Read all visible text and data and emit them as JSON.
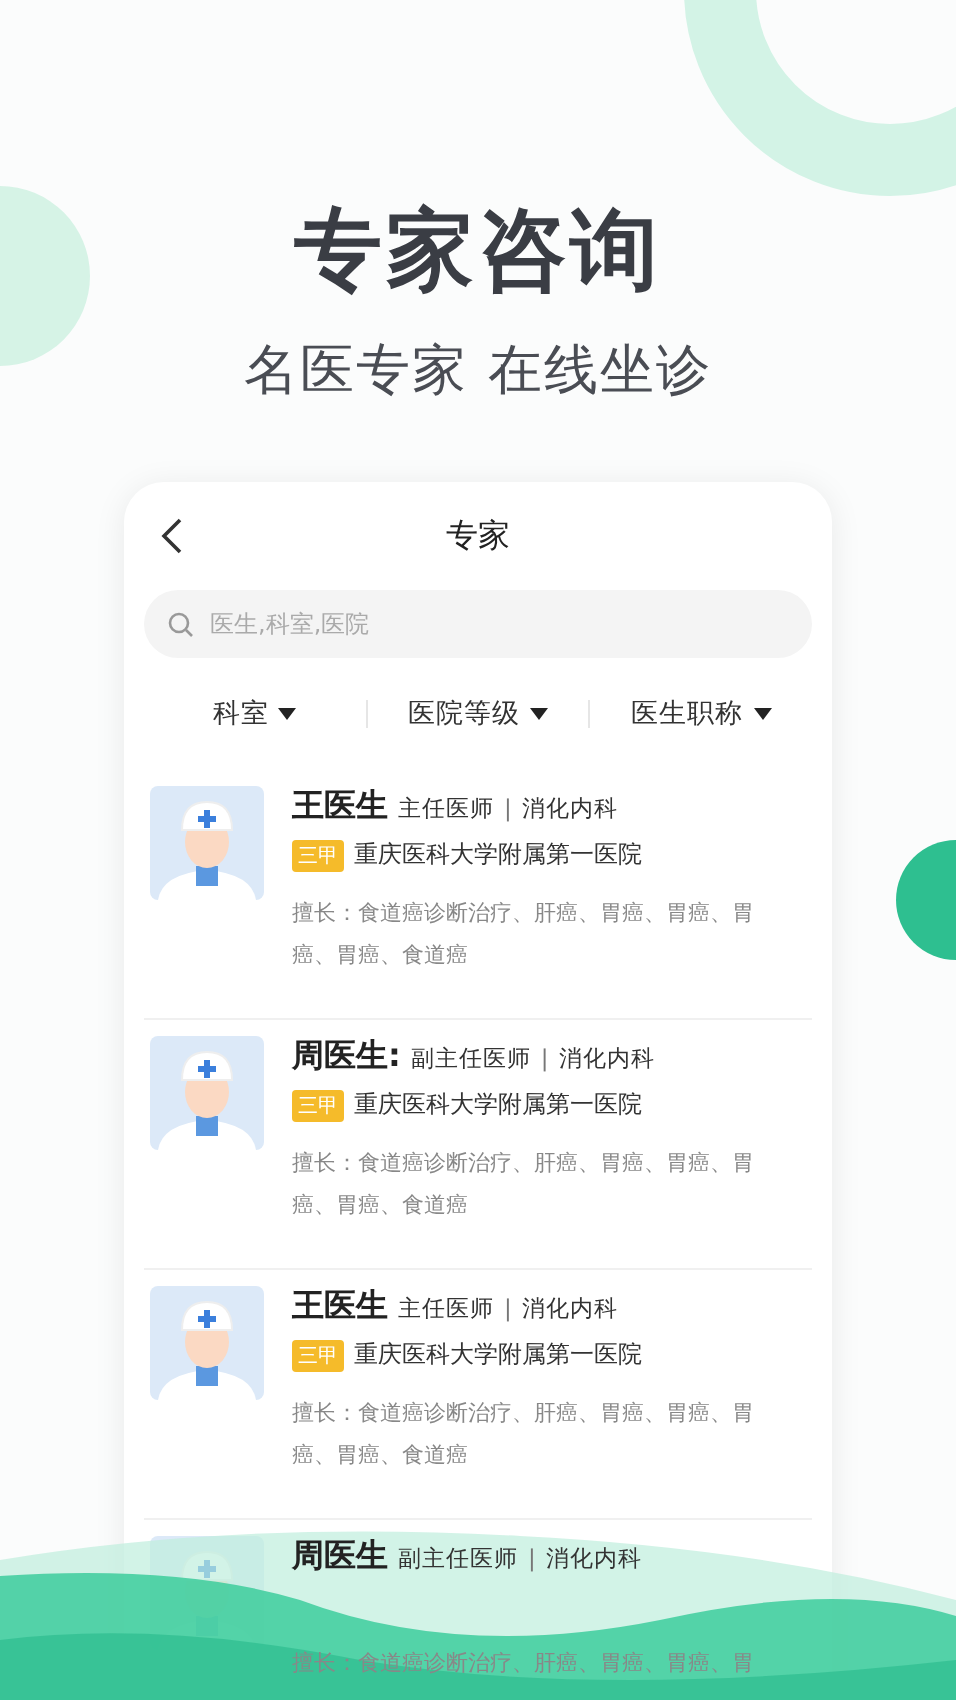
{
  "hero": {
    "title": "专家咨询",
    "subtitle": "名医专家 在线坐诊"
  },
  "screen": {
    "title": "专家",
    "search": {
      "placeholder": "医生,科室,医院"
    },
    "filters": [
      "科室",
      "医院等级",
      "医生职称"
    ],
    "doctors": [
      {
        "name": "王医生",
        "title": "主任医师",
        "separator": "|",
        "department": "消化内科",
        "grade": "三甲",
        "hospital": "重庆医科大学附属第一医院",
        "specialty": "擅长：食道癌诊断治疗、肝癌、胃癌、胃癌、胃癌、胃癌、食道癌"
      },
      {
        "name": "周医生:",
        "title": "副主任医师",
        "separator": "|",
        "department": "消化内科",
        "grade": "三甲",
        "hospital": "重庆医科大学附属第一医院",
        "specialty": "擅长：食道癌诊断治疗、肝癌、胃癌、胃癌、胃癌、胃癌、食道癌"
      },
      {
        "name": "王医生",
        "title": "主任医师",
        "separator": "|",
        "department": "消化内科",
        "grade": "三甲",
        "hospital": "重庆医科大学附属第一医院",
        "specialty": "擅长：食道癌诊断治疗、肝癌、胃癌、胃癌、胃癌、胃癌、食道癌"
      },
      {
        "name": "周医生",
        "title": "副主任医师",
        "separator": "|",
        "department": "消化内科",
        "specialty": "擅长：食道癌诊断治疗、肝癌、胃癌、胃癌、胃"
      }
    ]
  }
}
